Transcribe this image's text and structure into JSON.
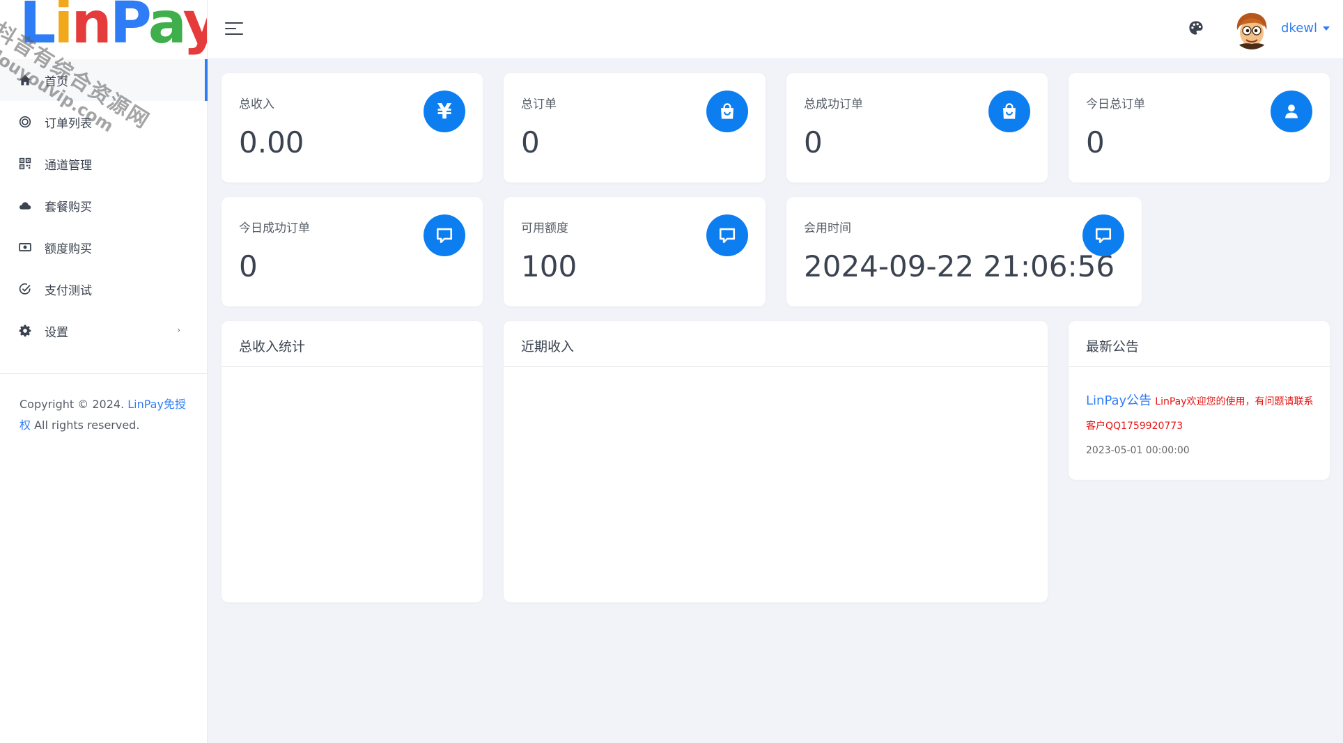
{
  "brand": {
    "logo_text": "LinPay",
    "watermark_line1": "抖音有综合资源网",
    "watermark_line2": "douyouvip.com"
  },
  "sidebar": {
    "items": [
      {
        "label": "首页",
        "icon": "home-icon",
        "active": true
      },
      {
        "label": "订单列表",
        "icon": "target-icon"
      },
      {
        "label": "通道管理",
        "icon": "qrcode-icon"
      },
      {
        "label": "套餐购买",
        "icon": "cloud-icon"
      },
      {
        "label": "额度购买",
        "icon": "money-icon"
      },
      {
        "label": "支付测试",
        "icon": "check-circle-icon"
      },
      {
        "label": "设置",
        "icon": "gear-icon",
        "has_submenu": true
      }
    ],
    "copyright": {
      "prefix": "Copyright © 2024. ",
      "link": "LinPay免授权",
      "suffix": " All rights reserved."
    }
  },
  "header": {
    "menu_toggle_icon": "hamburger-icon",
    "theme_icon": "palette-icon",
    "username": "dkewl"
  },
  "stats": [
    {
      "label": "总收入",
      "value": "0.00",
      "icon": "yen-icon"
    },
    {
      "label": "总订单",
      "value": "0",
      "icon": "shopping-bag-icon"
    },
    {
      "label": "总成功订单",
      "value": "0",
      "icon": "shopping-bag-icon"
    },
    {
      "label": "今日总订单",
      "value": "0",
      "icon": "user-icon"
    },
    {
      "label": "今日成功订单",
      "value": "0",
      "icon": "message-icon"
    },
    {
      "label": "可用额度",
      "value": "100",
      "icon": "message-icon"
    },
    {
      "label": "会用时间",
      "value": "2024-09-22 21:06:56",
      "icon": "message-icon"
    }
  ],
  "panels": {
    "total_income": {
      "title": "总收入统计"
    },
    "recent_income": {
      "title": "近期收入"
    },
    "notice": {
      "title": "最新公告",
      "item": {
        "heading": "LinPay公告",
        "text": "LinPay欢迎您的使用，有问题请联系客户QQ1759920773",
        "date": "2023-05-01 00:00:00"
      }
    }
  },
  "colors": {
    "accent": "#0d7ef0",
    "link": "#2f7df6",
    "notice_text": "#e61414",
    "background": "#f2f3f8"
  }
}
